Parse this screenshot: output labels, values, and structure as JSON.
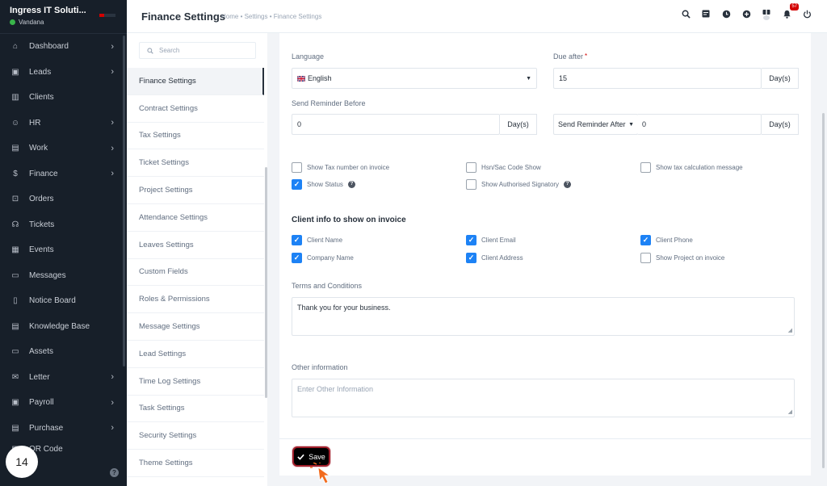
{
  "sidebar": {
    "company": "Ingress IT Soluti...",
    "user": "Vandana",
    "items": [
      {
        "label": "Dashboard",
        "icon": "house-icon",
        "glyph": "⌂",
        "arrow": true
      },
      {
        "label": "Leads",
        "icon": "id-card-icon",
        "glyph": "▣",
        "arrow": true
      },
      {
        "label": "Clients",
        "icon": "building-icon",
        "glyph": "▥",
        "arrow": false
      },
      {
        "label": "HR",
        "icon": "people-icon",
        "glyph": "☺",
        "arrow": true
      },
      {
        "label": "Work",
        "icon": "briefcase-icon",
        "glyph": "▤",
        "arrow": true
      },
      {
        "label": "Finance",
        "icon": "dollar-icon",
        "glyph": "$",
        "arrow": true
      },
      {
        "label": "Orders",
        "icon": "cart-icon",
        "glyph": "⊡",
        "arrow": false
      },
      {
        "label": "Tickets",
        "icon": "headset-icon",
        "glyph": "☊",
        "arrow": false
      },
      {
        "label": "Events",
        "icon": "calendar-icon",
        "glyph": "▦",
        "arrow": false
      },
      {
        "label": "Messages",
        "icon": "chat-icon",
        "glyph": "▭",
        "arrow": false
      },
      {
        "label": "Notice Board",
        "icon": "clipboard-icon",
        "glyph": "▯",
        "arrow": false
      },
      {
        "label": "Knowledge Base",
        "icon": "document-icon",
        "glyph": "▤",
        "arrow": false
      },
      {
        "label": "Assets",
        "icon": "monitor-icon",
        "glyph": "▭",
        "arrow": false
      },
      {
        "label": "Letter",
        "icon": "envelope-icon",
        "glyph": "✉",
        "arrow": true
      },
      {
        "label": "Payroll",
        "icon": "wallet-icon",
        "glyph": "▣",
        "arrow": true
      },
      {
        "label": "Purchase",
        "icon": "receipt-icon",
        "glyph": "▤",
        "arrow": true
      },
      {
        "label": "QR Code",
        "icon": "qr-icon",
        "glyph": "▦",
        "arrow": false
      }
    ],
    "step_number": "14"
  },
  "header": {
    "title": "Finance Settings",
    "breadcrumb": "Home • Settings • Finance Settings",
    "notification_count": "57"
  },
  "settings_nav": {
    "search_placeholder": "Search",
    "items": [
      "Finance Settings",
      "Contract Settings",
      "Tax Settings",
      "Ticket Settings",
      "Project Settings",
      "Attendance Settings",
      "Leaves Settings",
      "Custom Fields",
      "Roles & Permissions",
      "Message Settings",
      "Lead Settings",
      "Time Log Settings",
      "Task Settings",
      "Security Settings",
      "Theme Settings"
    ],
    "active_index": 0
  },
  "form": {
    "language_label": "Language",
    "language_value": "English",
    "due_after_label": "Due after",
    "due_after_value": "15",
    "due_after_unit": "Day(s)",
    "send_reminder_before_label": "Send Reminder Before",
    "send_reminder_before_value": "0",
    "send_reminder_before_unit": "Day(s)",
    "send_reminder_after_select": "Send Reminder After",
    "send_reminder_after_value": "0",
    "send_reminder_after_unit": "Day(s)",
    "options": [
      {
        "label": "Show Tax number on invoice",
        "checked": false
      },
      {
        "label": "Hsn/Sac Code Show",
        "checked": false
      },
      {
        "label": "Show tax calculation message",
        "checked": false
      },
      {
        "label": "Show Status",
        "checked": true
      },
      {
        "label": "Show Authorised Signatory",
        "checked": false
      }
    ],
    "client_info_title": "Client info to show on invoice",
    "client_info": [
      {
        "label": "Client Name",
        "checked": true
      },
      {
        "label": "Client Email",
        "checked": true
      },
      {
        "label": "Client Phone",
        "checked": true
      },
      {
        "label": "Company Name",
        "checked": true
      },
      {
        "label": "Client Address",
        "checked": true
      },
      {
        "label": "Show Project on invoice",
        "checked": false
      }
    ],
    "terms_label": "Terms and Conditions",
    "terms_value": "Thank you for your business.",
    "other_info_label": "Other information",
    "other_info_placeholder": "Enter Other Information",
    "save_label": "Save"
  },
  "colors": {
    "accent": "#1d82f5",
    "sidebar_bg": "#171f29",
    "save_border": "#a01e2a",
    "cursor": "#f26b1d"
  }
}
